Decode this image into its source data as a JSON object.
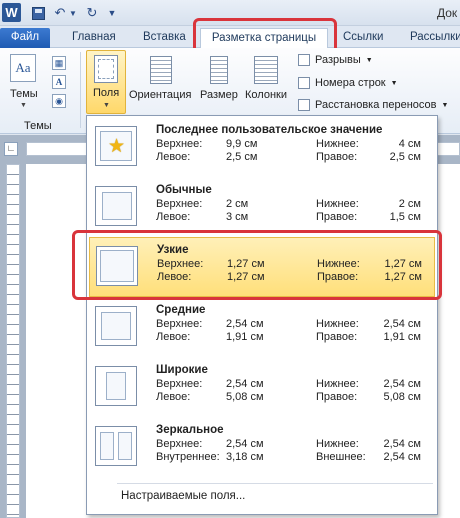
{
  "title_bar": {
    "app_icon": "W",
    "title": "Док",
    "quick_access": [
      "save-icon",
      "undo-icon",
      "redo-icon",
      "customize-icon"
    ]
  },
  "tabs": [
    {
      "label": "Файл",
      "active": false
    },
    {
      "label": "Главная",
      "active": false
    },
    {
      "label": "Вставка",
      "active": false
    },
    {
      "label": "Разметка страницы",
      "active": true
    },
    {
      "label": "Ссылки",
      "active": false
    },
    {
      "label": "Рассылки",
      "active": false
    }
  ],
  "ribbon": {
    "themes": {
      "button_label": "Темы",
      "group_label": "Темы"
    },
    "page_setup": {
      "fields_label": "Поля",
      "orientation_label": "Ориентация",
      "size_label": "Размер",
      "columns_label": "Колонки",
      "breaks_label": "Разрывы",
      "line_numbers_label": "Номера строк",
      "hyphenation_label": "Расстановка переносов"
    }
  },
  "margins_menu": {
    "items": [
      {
        "title": "Последнее пользовательское значение",
        "label1": "Верхнее:",
        "value1": "9,9 см",
        "label2": "Нижнее:",
        "value2": "4 см",
        "label3": "Левое:",
        "value3": "2,5 см",
        "label4": "Правое:",
        "value4": "2,5 см",
        "selected": false,
        "icon": "star-icon"
      },
      {
        "title": "Обычные",
        "label1": "Верхнее:",
        "value1": "2 см",
        "label2": "Нижнее:",
        "value2": "2 см",
        "label3": "Левое:",
        "value3": "3 см",
        "label4": "Правое:",
        "value4": "1,5 см",
        "selected": false,
        "icon": "margins-normal-icon"
      },
      {
        "title": "Узкие",
        "label1": "Верхнее:",
        "value1": "1,27 см",
        "label2": "Нижнее:",
        "value2": "1,27 см",
        "label3": "Левое:",
        "value3": "1,27 см",
        "label4": "Правое:",
        "value4": "1,27 см",
        "selected": true,
        "icon": "margins-narrow-icon"
      },
      {
        "title": "Средние",
        "label1": "Верхнее:",
        "value1": "2,54 см",
        "label2": "Нижнее:",
        "value2": "2,54 см",
        "label3": "Левое:",
        "value3": "1,91 см",
        "label4": "Правое:",
        "value4": "1,91 см",
        "selected": false,
        "icon": "margins-moderate-icon"
      },
      {
        "title": "Широкие",
        "label1": "Верхнее:",
        "value1": "2,54 см",
        "label2": "Нижнее:",
        "value2": "2,54 см",
        "label3": "Левое:",
        "value3": "5,08 см",
        "label4": "Правое:",
        "value4": "5,08 см",
        "selected": false,
        "icon": "margins-wide-icon"
      },
      {
        "title": "Зеркальное",
        "label1": "Верхнее:",
        "value1": "2,54 см",
        "label2": "Нижнее:",
        "value2": "2,54 см",
        "label3": "Внутреннее:",
        "value3": "3,18 см",
        "label4": "Внешнее:",
        "value4": "2,54 см",
        "selected": false,
        "icon": "margins-mirrored-icon"
      }
    ],
    "custom_label": "Настраиваемые поля..."
  },
  "colors": {
    "highlight": "#d9343b",
    "selected_fill": "#ffe08a",
    "file_tab": "#2a64bf"
  }
}
